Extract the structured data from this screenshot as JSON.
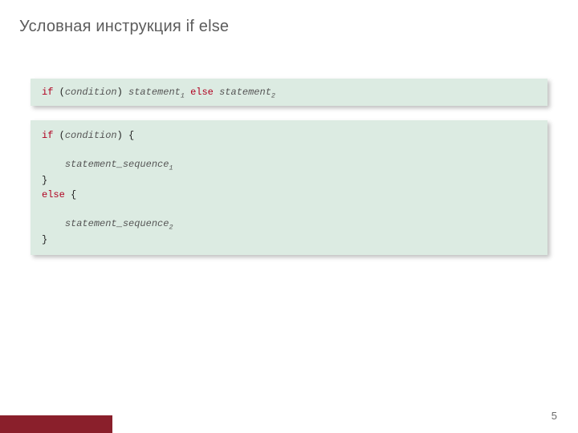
{
  "title": "Условная инструкция if else",
  "page_number": "5",
  "colors": {
    "codebox_bg": "#dcebe2",
    "keyword": "#b00020",
    "accent_bar": "#8a1f2b",
    "title_color": "#5c5c5c"
  },
  "box1": {
    "kw_if": "if",
    "open": " (",
    "condition": "condition",
    "close": ") ",
    "stmt1": "statement",
    "sub1": "1",
    "sp_else": " ",
    "kw_else": "else",
    "sp2": " ",
    "stmt2": "statement",
    "sub2": "2"
  },
  "box2": {
    "l1_if": "if",
    "l1_open": " (",
    "l1_cond": "condition",
    "l1_close": ") {",
    "l2_blank": " ",
    "l3_indent": "    ",
    "l3_seq": "statement_sequence",
    "l3_sub": "1",
    "l4_close": "}",
    "l5_else": "else",
    "l5_brace": " {",
    "l6_blank": " ",
    "l7_indent": "    ",
    "l7_seq": "statement_sequence",
    "l7_sub": "2",
    "l8_close": "}"
  }
}
